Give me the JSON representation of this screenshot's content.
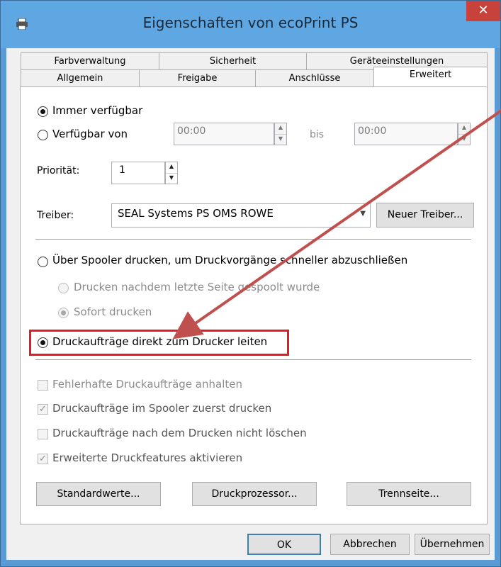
{
  "window": {
    "title": "Eigenschaften von ecoPrint PS",
    "close_glyph": "✕"
  },
  "tabs_row1": [
    "Farbverwaltung",
    "Sicherheit",
    "Geräteeinstellungen"
  ],
  "tabs_row2": [
    "Allgemein",
    "Freigabe",
    "Anschlüsse",
    "Erweitert"
  ],
  "availability": {
    "always": "Immer verfügbar",
    "from": "Verfügbar von",
    "from_time": "00:00",
    "to_label": "bis",
    "to_time": "00:00"
  },
  "priority": {
    "label": "Priorität:",
    "value": "1"
  },
  "driver": {
    "label": "Treiber:",
    "value": "SEAL Systems PS OMS ROWE",
    "new_button": "Neuer Treiber..."
  },
  "spool": {
    "via_spooler": "Über Spooler drucken, um Druckvorgänge schneller abzuschließen",
    "after_last_page": "Drucken nachdem letzte Seite gespoolt wurde",
    "immediately": "Sofort drucken",
    "direct": "Druckaufträge direkt zum Drucker leiten"
  },
  "options": {
    "hold_mismatched": "Fehlerhafte Druckaufträge anhalten",
    "spooled_first": "Druckaufträge im Spooler zuerst drucken",
    "keep_printed": "Druckaufträge nach dem Drucken nicht löschen",
    "advanced_features": "Erweiterte Druckfeatures aktivieren"
  },
  "buttons": {
    "defaults": "Standardwerte...",
    "processor": "Druckprozessor...",
    "separator": "Trennseite...",
    "ok": "OK",
    "cancel": "Abbrechen",
    "apply": "Übernehmen"
  },
  "colors": {
    "highlight": "#e31b23",
    "arrow": "#c0504d"
  }
}
